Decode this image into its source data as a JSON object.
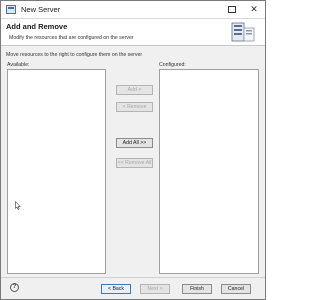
{
  "window": {
    "title": "New Server",
    "app_icon": "server-wizard-icon"
  },
  "header": {
    "title": "Add and Remove",
    "description": "Modify the resources that are configured on the server",
    "graphic": "server-wizard-graphic"
  },
  "main": {
    "instruction": "Move resources to the right to configure them on the server",
    "available_label": "Available:",
    "configured_label": "Configured:",
    "available_items": [],
    "configured_items": [],
    "buttons": {
      "add": "Add >",
      "remove": "< Remove",
      "add_all": "Add All >>",
      "remove_all": "<< Remove All"
    }
  },
  "footer": {
    "help_icon": "help-icon",
    "help_glyph": "?",
    "back": "< Back",
    "next": "Next >",
    "finish": "Finish",
    "cancel": "Cancel"
  },
  "colors": {
    "accent": "#3c78c8",
    "window_bg": "#f0f0f0",
    "list_bg": "#ffffff",
    "disabled_text": "#a6a6a6"
  }
}
